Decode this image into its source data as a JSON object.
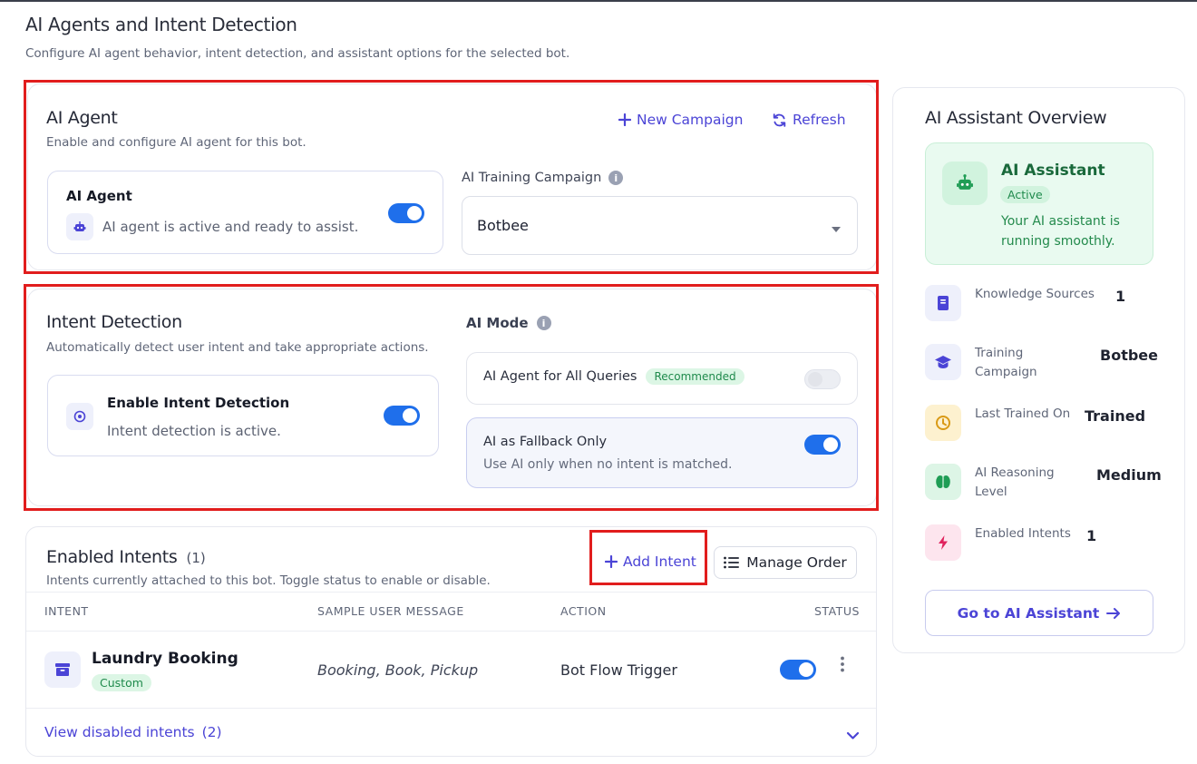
{
  "page": {
    "title": "AI Agents and Intent Detection",
    "subtitle": "Configure AI agent behavior, intent detection, and assistant options for the selected bot."
  },
  "ai_agent_section": {
    "title": "AI Agent",
    "subtitle": "Enable and configure AI agent for this bot.",
    "new_campaign_label": "New Campaign",
    "refresh_label": "Refresh",
    "toggle_card": {
      "label": "AI Agent",
      "status": "AI agent is active and ready to assist.",
      "enabled": true
    },
    "campaign": {
      "label": "AI Training Campaign",
      "info": "i",
      "selected": "Botbee"
    }
  },
  "intent_detection_section": {
    "title": "Intent Detection",
    "subtitle": "Automatically detect user intent and take appropriate actions.",
    "toggle_card": {
      "label": "Enable Intent Detection",
      "status": "Intent detection is active.",
      "enabled": true
    },
    "ai_mode": {
      "label": "AI Mode",
      "info": "i",
      "options": [
        {
          "label": "AI Agent for All Queries",
          "badge": "Recommended",
          "enabled": false
        },
        {
          "label": "AI as Fallback Only",
          "description": "Use AI only when no intent is matched.",
          "enabled": true
        }
      ]
    }
  },
  "enabled_intents": {
    "title": "Enabled Intents",
    "count": "(1)",
    "subtitle": "Intents currently attached to this bot. Toggle status to enable or disable.",
    "add_intent_label": "Add Intent",
    "manage_order_label": "Manage Order",
    "columns": [
      "INTENT",
      "SAMPLE USER MESSAGE",
      "ACTION",
      "STATUS"
    ],
    "rows": [
      {
        "name": "Laundry Booking",
        "tag": "Custom",
        "sample": "Booking, Book, Pickup",
        "action": "Bot Flow Trigger",
        "enabled": true
      }
    ],
    "view_disabled_label": "View disabled intents",
    "view_disabled_count": "(2)"
  },
  "overview": {
    "title": "AI Assistant Overview",
    "assistant": {
      "name": "AI Assistant",
      "badge": "Active",
      "message": "Your AI assistant is running smoothly."
    },
    "stats": [
      {
        "label": "Knowledge Sources",
        "value": "1",
        "icon": "book-icon",
        "color": "#4b44d6"
      },
      {
        "label": "Training Campaign",
        "value": "Botbee",
        "icon": "graduation-cap-icon",
        "color": "#4b44d6"
      },
      {
        "label": "Last Trained On",
        "value": "Trained",
        "icon": "clock-icon",
        "color": "#d99a16"
      },
      {
        "label": "AI Reasoning Level",
        "value": "Medium",
        "icon": "brain-icon",
        "color": "#1f9d55"
      },
      {
        "label": "Enabled Intents",
        "value": "1",
        "icon": "bolt-icon",
        "color": "#e0245e"
      }
    ],
    "cta_label": "Go to AI Assistant"
  },
  "colors": {
    "accent": "#4b44d6",
    "toggle_on": "#1f6feb",
    "highlight_border": "#e11d1d",
    "assistant_bg": "#e9faf0"
  }
}
